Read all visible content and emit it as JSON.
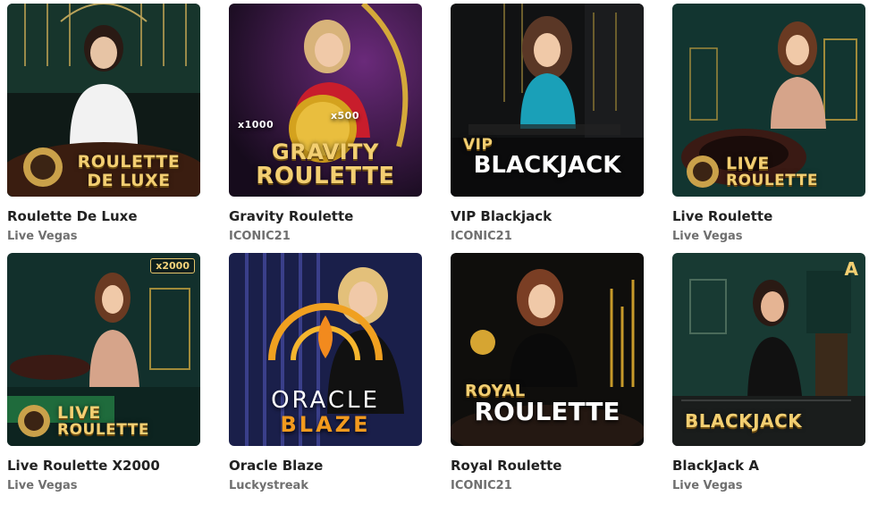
{
  "games": [
    {
      "title": "Roulette De Luxe",
      "provider": "Live Vegas",
      "logo": [
        "ROULETTE",
        "DE LUXE"
      ],
      "badge": ""
    },
    {
      "title": "Gravity Roulette",
      "provider": "ICONIC21",
      "logo": [
        "GRAVITY",
        "ROULETTE"
      ],
      "extra": [
        "x1000",
        "x500"
      ]
    },
    {
      "title": "VIP Blackjack",
      "provider": "ICONIC21",
      "logo": [
        "VIP",
        "BLACKJACK"
      ]
    },
    {
      "title": "Live Roulette",
      "provider": "Live Vegas",
      "logo": [
        "LIVE",
        "ROULETTE"
      ]
    },
    {
      "title": "Live Roulette X2000",
      "provider": "Live Vegas",
      "logo": [
        "LIVE",
        "ROULETTE"
      ],
      "badge": "x2000"
    },
    {
      "title": "Oracle Blaze",
      "provider": "Luckystreak",
      "logo": [
        "ORACLE",
        "BLAZE"
      ]
    },
    {
      "title": "Royal Roulette",
      "provider": "ICONIC21",
      "logo": [
        "ROYAL",
        "ROULETTE"
      ]
    },
    {
      "title": "BlackJack A",
      "provider": "Live Vegas",
      "logo": [
        "BLACKJACK"
      ],
      "corner": "A"
    }
  ]
}
